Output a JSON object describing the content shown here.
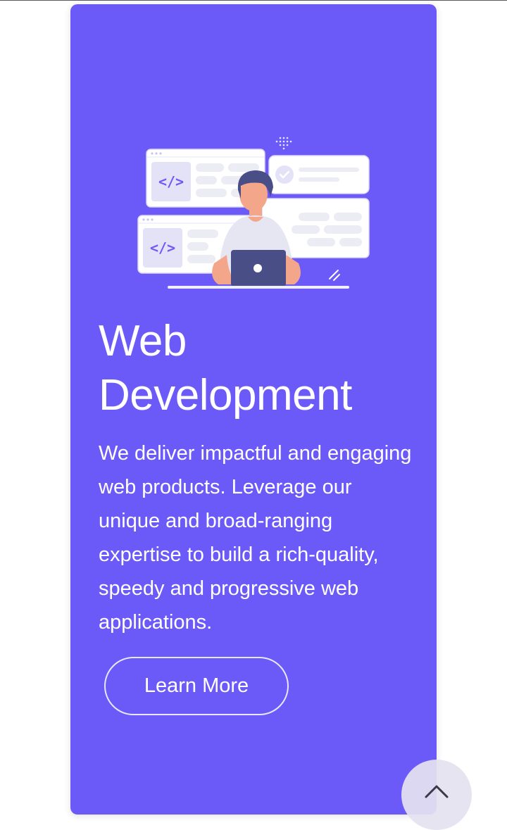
{
  "card": {
    "title": "Web Development",
    "description": "We deliver impactful and engaging web products. Leverage our unique and broad-ranging expertise to build a rich-quality, speedy and progressive web applications.",
    "button_label": "Learn More",
    "illustration": "developer-at-laptop-illustration",
    "code_tags": [
      "</>",
      "</>"
    ]
  },
  "scroll_top": {
    "icon": "chevron-up-icon"
  },
  "colors": {
    "card_background": "#6c5af8",
    "text": "#ffffff",
    "scroll_button": "#e4e2f0"
  }
}
